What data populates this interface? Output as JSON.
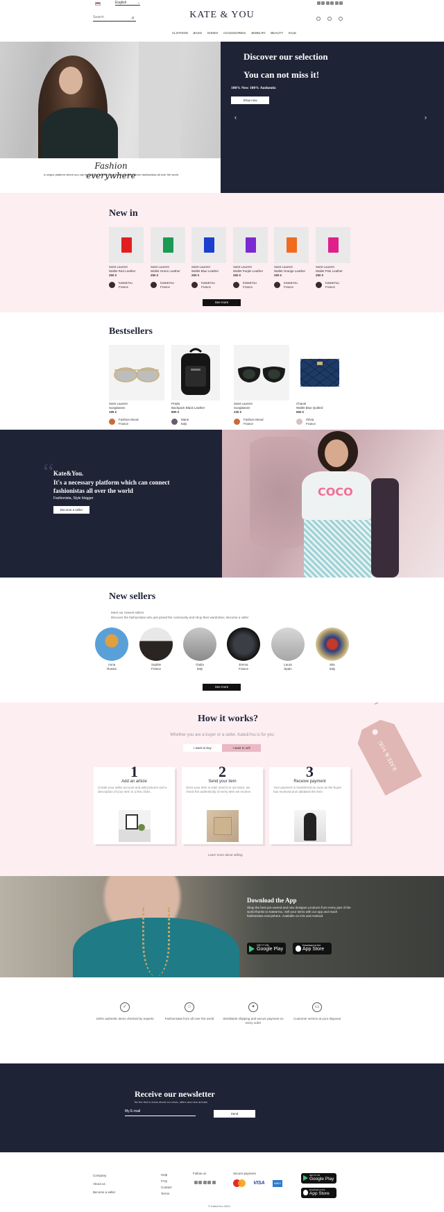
{
  "header": {
    "language": "English",
    "search_placeholder": "Search",
    "logo": "KATE & YOU",
    "nav": [
      "Clothing",
      "Bags",
      "Shoes",
      "Accessories",
      "Jewelry",
      "Beauty",
      "Sale"
    ]
  },
  "hero": {
    "script_title": "Fashion everywhere",
    "caption": "A unique platform where you can find stylish second-hand and new pieces from fashionistas all over the world",
    "title1": "Discover our selection",
    "title2": "You can not miss it!",
    "subtitle": "100% New 100% Authentic",
    "button": "Shop now"
  },
  "new_in": {
    "title": "New in",
    "products": [
      {
        "brand": "Saint Laurent",
        "name": "Wallet Red Leather",
        "price": "250 €",
        "seller": "Kate&You",
        "country": "France",
        "color": "#e02020"
      },
      {
        "brand": "Saint Laurent",
        "name": "Wallet Green Leather",
        "price": "250 €",
        "seller": "Kate&You",
        "country": "France",
        "color": "#1a9a52"
      },
      {
        "brand": "Saint Laurent",
        "name": "Wallet Blue Leather",
        "price": "250 €",
        "seller": "Kate&You",
        "country": "France",
        "color": "#1c3fd0"
      },
      {
        "brand": "Saint Laurent",
        "name": "Wallet Purple Leather",
        "price": "250 €",
        "seller": "Kate&You",
        "country": "France",
        "color": "#7a2ad0"
      },
      {
        "brand": "Saint Laurent",
        "name": "Wallet Orange Leather",
        "price": "250 €",
        "seller": "Kate&You",
        "country": "France",
        "color": "#f06a20"
      },
      {
        "brand": "Saint Laurent",
        "name": "Wallet Pink Leather",
        "price": "250 €",
        "seller": "Kate&You",
        "country": "France",
        "color": "#e0208a"
      }
    ],
    "button": "See more"
  },
  "bestsellers": {
    "title": "Bestsellers",
    "products": [
      {
        "brand": "Saint Laurent",
        "name": "Sunglasses",
        "price": "195 €",
        "seller": "Fashion Mood",
        "country": "France"
      },
      {
        "brand": "Prada",
        "name": "Backpack Black Leather",
        "price": "890 €",
        "seller": "Marie",
        "country": "Italy"
      },
      {
        "brand": "Saint Laurent",
        "name": "Sunglasses",
        "price": "230 €",
        "seller": "Fashion Mood",
        "country": "France"
      },
      {
        "brand": "Chanel",
        "name": "Wallet Blue Quilted",
        "price": "650 €",
        "seller": "Olivia",
        "country": "France"
      }
    ]
  },
  "quote": {
    "brand": "Kate&You.",
    "text": "It's a necessary platform which can connect fashionistas all over the world",
    "author": "Fashionista, Style blogger",
    "button": "Become a seller",
    "tshirt": "COCO"
  },
  "new_sellers": {
    "title": "New sellers",
    "subtitle": "Meet our newest sellers",
    "description": "Discover the fashionistas who just joined the community and shop their wardrobes. Become a seller",
    "sellers": [
      {
        "name": "Anna",
        "country": "Russia"
      },
      {
        "name": "Sophie",
        "country": "France"
      },
      {
        "name": "Giulia",
        "country": "Italy"
      },
      {
        "name": "Emma",
        "country": "France"
      },
      {
        "name": "Laura",
        "country": "Spain"
      },
      {
        "name": "Mia",
        "country": "Italy"
      }
    ],
    "button": "See more"
  },
  "how": {
    "title": "How it works?",
    "subtitle": "Whether you are a buyer or a seller, Kate&You is for you",
    "tab_buy": "I want to buy",
    "tab_sell": "I want to sell",
    "tag_text": "KATE & YOU",
    "steps": [
      {
        "num": "1",
        "title": "Add an article",
        "text": "Create your seller account and add pictures and a description of your item in a few clicks."
      },
      {
        "num": "2",
        "title": "Send your item",
        "text": "Once your item is sold, send it to our team, we check the authenticity of every item we receive."
      },
      {
        "num": "3",
        "title": "Receive payment",
        "text": "Your payment is transferred as soon as the buyer has received and validated the item."
      }
    ],
    "link": "Learn more about selling"
  },
  "app": {
    "title": "Download the App",
    "text": "Shop the best pre-owned and new designer products from every part of the world thanks to Kate&You. Sell your items with our app and reach fashionistas everywhere. Available on iOS and Android.",
    "google_small": "GET IT ON",
    "google": "Google Play",
    "apple_small": "Download on the",
    "apple": "App Store"
  },
  "features": [
    {
      "icon": "shield-icon",
      "text": "100% authentic items checked by experts"
    },
    {
      "icon": "star-icon",
      "text": "Fashionistas from all over the world"
    },
    {
      "icon": "badge-icon",
      "text": "Worldwide shipping and secure payment on every order"
    },
    {
      "icon": "box-icon",
      "text": "Customer service at your disposal"
    }
  ],
  "newsletter": {
    "title": "Receive our newsletter",
    "subtitle": "Be the first to know about our news, offers and new arrivals",
    "placeholder": "My E-mail",
    "button": "Send"
  },
  "footer": {
    "col1": [
      "Company",
      "About us",
      "Become a seller"
    ],
    "col2": [
      "Help",
      "FAQ",
      "Contact",
      "Terms"
    ],
    "col3_title": "Follow us",
    "col4_title": "Secure payment",
    "payments": [
      "VISA",
      "AMEX"
    ],
    "copyright": "© Kate&You 2020"
  }
}
